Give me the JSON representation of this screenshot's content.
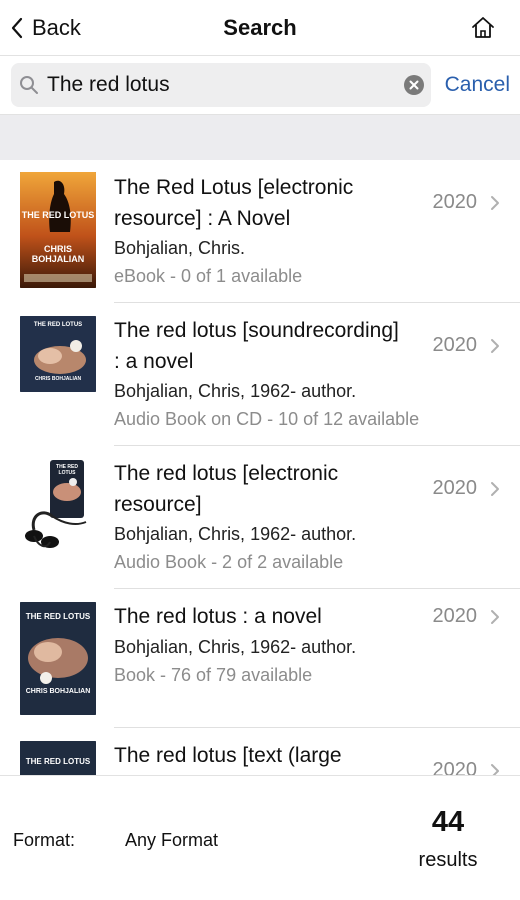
{
  "nav": {
    "back_label": "Back",
    "title": "Search"
  },
  "search": {
    "query": "The red lotus",
    "cancel_label": "Cancel"
  },
  "results": [
    {
      "title": "The Red Lotus [electronic resource] : A Novel",
      "author": "Bohjalian, Chris.",
      "format": "eBook - 0 of 1 available",
      "year": "2020",
      "cover_title": "THE RED LOTUS",
      "cover_author": "CHRIS BOHJALIAN"
    },
    {
      "title": "The red lotus [soundrecording] : a novel",
      "author": "Bohjalian, Chris, 1962- author.",
      "format": "Audio Book on CD - 10 of 12 available",
      "year": "2020",
      "cover_title": "THE RED LOTUS",
      "cover_author": "CHRIS BOHJALIAN"
    },
    {
      "title": "The red lotus [electronic resource]",
      "author": "Bohjalian, Chris, 1962- author.",
      "format": "Audio Book - 2 of 2 available",
      "year": "2020",
      "cover_title": "THE RED LOTUS",
      "cover_author": ""
    },
    {
      "title": "The red lotus : a novel",
      "author": "Bohjalian, Chris, 1962- author.",
      "format": "Book - 76 of 79 available",
      "year": "2020",
      "cover_title": "THE RED LOTUS",
      "cover_author": "CHRIS BOHJALIAN"
    },
    {
      "title": "The red lotus [text (large",
      "year": "2020",
      "cover_title": "THE RED LOTUS"
    }
  ],
  "filter": {
    "format_label": "Format:",
    "format_value": "Any Format"
  },
  "summary": {
    "count": "44",
    "count_label": "results"
  },
  "colors": {
    "accent": "#2a5fad",
    "muted_text": "#8c8c8c",
    "background_band": "#ececef"
  },
  "icons": [
    "chevron-left-icon",
    "home-icon",
    "search-icon",
    "clear-icon",
    "chevron-right-icon",
    "headphones-icon"
  ]
}
